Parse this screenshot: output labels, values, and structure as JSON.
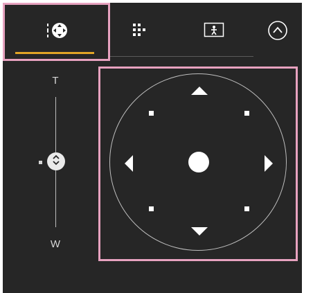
{
  "tabs": [
    {
      "icon": "ptz-control-icon",
      "selected": true
    },
    {
      "icon": "grid-icon",
      "selected": false
    },
    {
      "icon": "framing-icon",
      "selected": false
    },
    {
      "icon": "collapse-up-icon",
      "selected": false
    }
  ],
  "zoom": {
    "tele_label": "T",
    "wide_label": "W"
  },
  "colors": {
    "panel_background": "#262626",
    "highlight_border": "#e7a2bf",
    "active_tab_underline": "#e1a526",
    "control_white": "#ffffff"
  }
}
